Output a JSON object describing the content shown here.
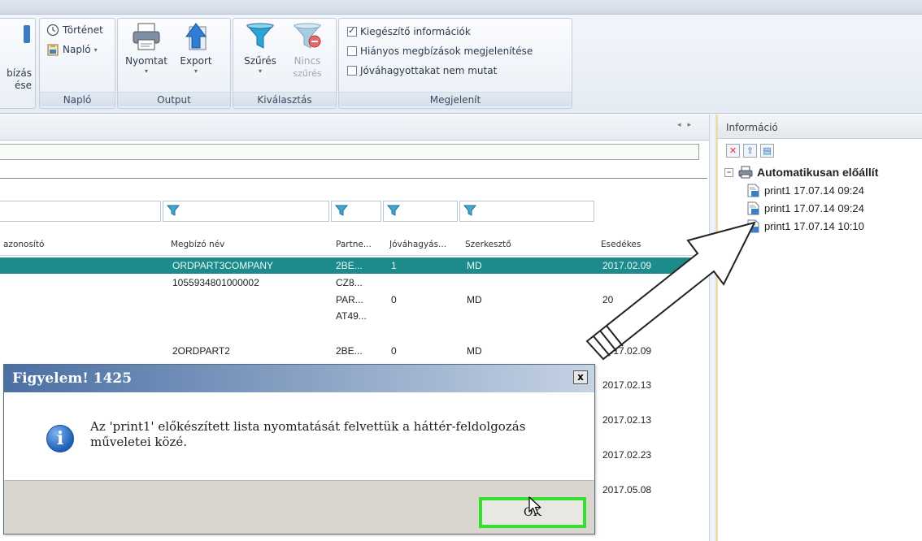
{
  "ribbon": {
    "groups": {
      "naplo": {
        "tortenet": "Történet",
        "naplo_btn": "Napló",
        "label": "Napló"
      },
      "left_partial": {
        "line1": "bízás",
        "line2": "ése"
      },
      "output": {
        "nyomtat": "Nyomtat",
        "export": "Export",
        "label": "Output"
      },
      "kivalasztas": {
        "szures": "Szűrés",
        "nincs": "Nincs",
        "szures2": "szűrés",
        "label": "Kiválasztás"
      },
      "megjelenit": {
        "opt1": "Kiegészítő információk",
        "opt2": "Hiányos megbízások megjelenítése",
        "opt3": "Jóváhagyottakat nem mutat",
        "label": "Megjelenít",
        "checked": [
          true,
          false,
          false
        ]
      }
    }
  },
  "grid": {
    "headers": {
      "azonosito": "azonosító",
      "megbizo": "Megbízó név",
      "partner": "Partne...",
      "jovahagyas": "Jóváhagyás...",
      "szerkeszto": "Szerkesztő",
      "esedekes": "Esedékes"
    },
    "rows": [
      {
        "megbizo": "ORDPART3COMPANY",
        "partner": "2BE...",
        "jov": "1",
        "szerk": "MD",
        "esed": "2017.02.09"
      },
      {
        "megbizo": "1055934801000002",
        "partner": "CZ8...",
        "jov": "",
        "szerk": "",
        "esed": ""
      },
      {
        "megbizo": "",
        "partner": "PAR...",
        "jov": "0",
        "szerk": "MD",
        "esed": "20"
      },
      {
        "megbizo": "",
        "partner": "AT49...",
        "jov": "",
        "szerk": "",
        "esed": ""
      },
      {
        "megbizo": "2ORDPART2",
        "partner": "2BE...",
        "jov": "0",
        "szerk": "MD",
        "esed": "2017.02.09"
      },
      {
        "esed": "2017.02.13"
      },
      {
        "esed": "2017.02.13"
      },
      {
        "esed": "2017.02.23"
      },
      {
        "esed": "2017.05.08"
      }
    ]
  },
  "info_panel": {
    "title": "Információ",
    "root": "Automatikusan előállít",
    "items": [
      "print1 17.07.14 09:24",
      "print1 17.07.14 09:24",
      "print1 17.07.14 10:10"
    ]
  },
  "dialog": {
    "title": "Figyelem! 1425",
    "close": "x",
    "message": "Az 'print1' előkészített lista nyomtatását felvettük a háttér-feldolgozás műveletei közé.",
    "ok": "OK"
  },
  "colors": {
    "selected_row": "#1d8b8b",
    "highlight": "#33e02f",
    "dialog_title": "#4a6fa3"
  }
}
